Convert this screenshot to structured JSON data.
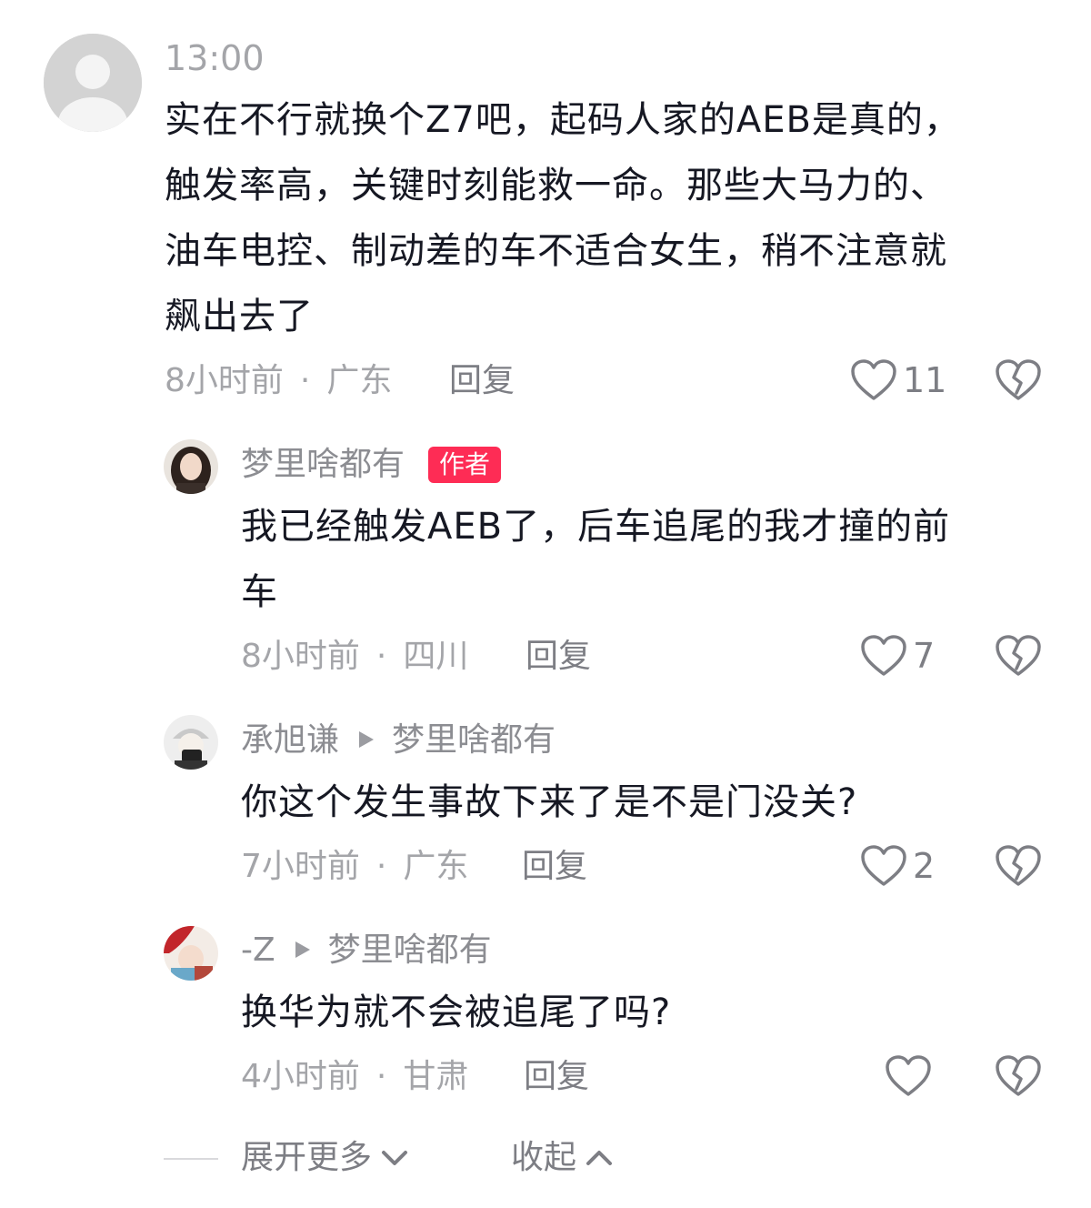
{
  "main_comment": {
    "timestamp": "13:00",
    "lines": [
      "实在不行就换个Z7吧，起码人家的AEB是真的，",
      "触发率高，关键时刻能救一命。那些大马力的、",
      "油车电控、制动差的车不适合女生，稍不注意就",
      "飙出去了"
    ],
    "time_ago": "8小时前",
    "location": "广东",
    "reply_label": "回复",
    "likes": "11"
  },
  "replies": [
    {
      "user": "梦里啥都有",
      "badge": "作者",
      "lines": [
        "我已经触发AEB了，后车追尾的我才撞的前",
        "车"
      ],
      "time_ago": "8小时前",
      "location": "四川",
      "reply_label": "回复",
      "likes": "7"
    },
    {
      "user": "承旭谦",
      "reply_to": "梦里啥都有",
      "lines": [
        "你这个发生事故下来了是不是门没关?"
      ],
      "time_ago": "7小时前",
      "location": "广东",
      "reply_label": "回复",
      "likes": "2"
    },
    {
      "user": "-Z",
      "reply_to": "梦里啥都有",
      "lines": [
        "换华为就不会被追尾了吗?"
      ],
      "time_ago": "4小时前",
      "location": "甘肃",
      "reply_label": "回复",
      "likes": ""
    }
  ],
  "footer": {
    "expand_label": "展开更多",
    "collapse_label": "收起"
  },
  "colors": {
    "badge": "#fe2c55",
    "text": "#161823",
    "meta": "#a4a5a9"
  },
  "icons": [
    "default-avatar-icon",
    "heart-icon",
    "broken-heart-icon",
    "chevron-down-icon",
    "chevron-up-icon"
  ]
}
